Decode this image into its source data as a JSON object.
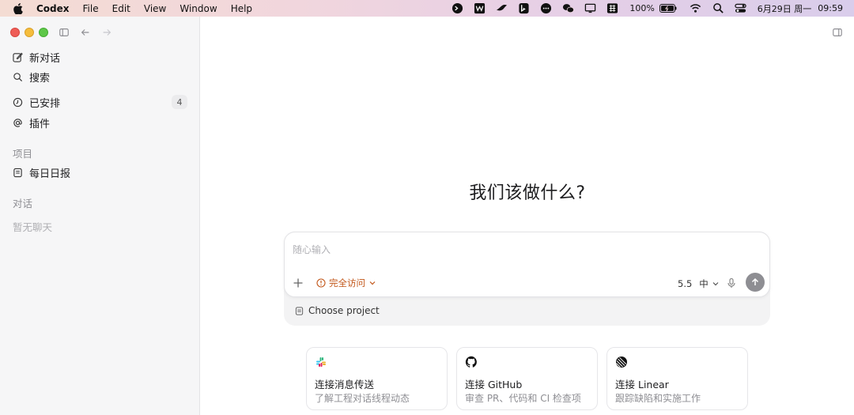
{
  "menubar": {
    "items": [
      "Codex",
      "File",
      "Edit",
      "View",
      "Window",
      "Help"
    ],
    "battery": "100%",
    "date": "6月29日 周一",
    "time": "09:59"
  },
  "sidebar": {
    "nav": [
      {
        "label": "新对话",
        "icon": "compose-icon"
      },
      {
        "label": "搜索",
        "icon": "search-icon"
      },
      {
        "label": "已安排",
        "icon": "clock-icon",
        "badge": "4"
      },
      {
        "label": "插件",
        "icon": "at-icon"
      }
    ],
    "projects_label": "项目",
    "projects": [
      {
        "label": "每日日报",
        "icon": "document-icon"
      }
    ],
    "conversations_label": "对话",
    "conversations_empty": "暂无聊天"
  },
  "main": {
    "heading": "我们该做什么?",
    "composer": {
      "placeholder": "随心输入",
      "access_label": "完全访问",
      "model_version": "5.5",
      "model_level": "中",
      "project_label": "Choose project"
    },
    "cards": [
      {
        "title": "连接消息传送",
        "subtitle": "了解工程对话线程动态",
        "icon": "slack-icon"
      },
      {
        "title": "连接 GitHub",
        "subtitle": "审查 PR、代码和 CI 检查项",
        "icon": "github-icon"
      },
      {
        "title": "连接 Linear",
        "subtitle": "跟踪缺陷和实施工作",
        "icon": "linear-icon"
      }
    ]
  },
  "colors": {
    "accent_orange": "#c2571a",
    "send_button": "#8e8e93",
    "sidebar_bg": "#f6f6f7"
  }
}
